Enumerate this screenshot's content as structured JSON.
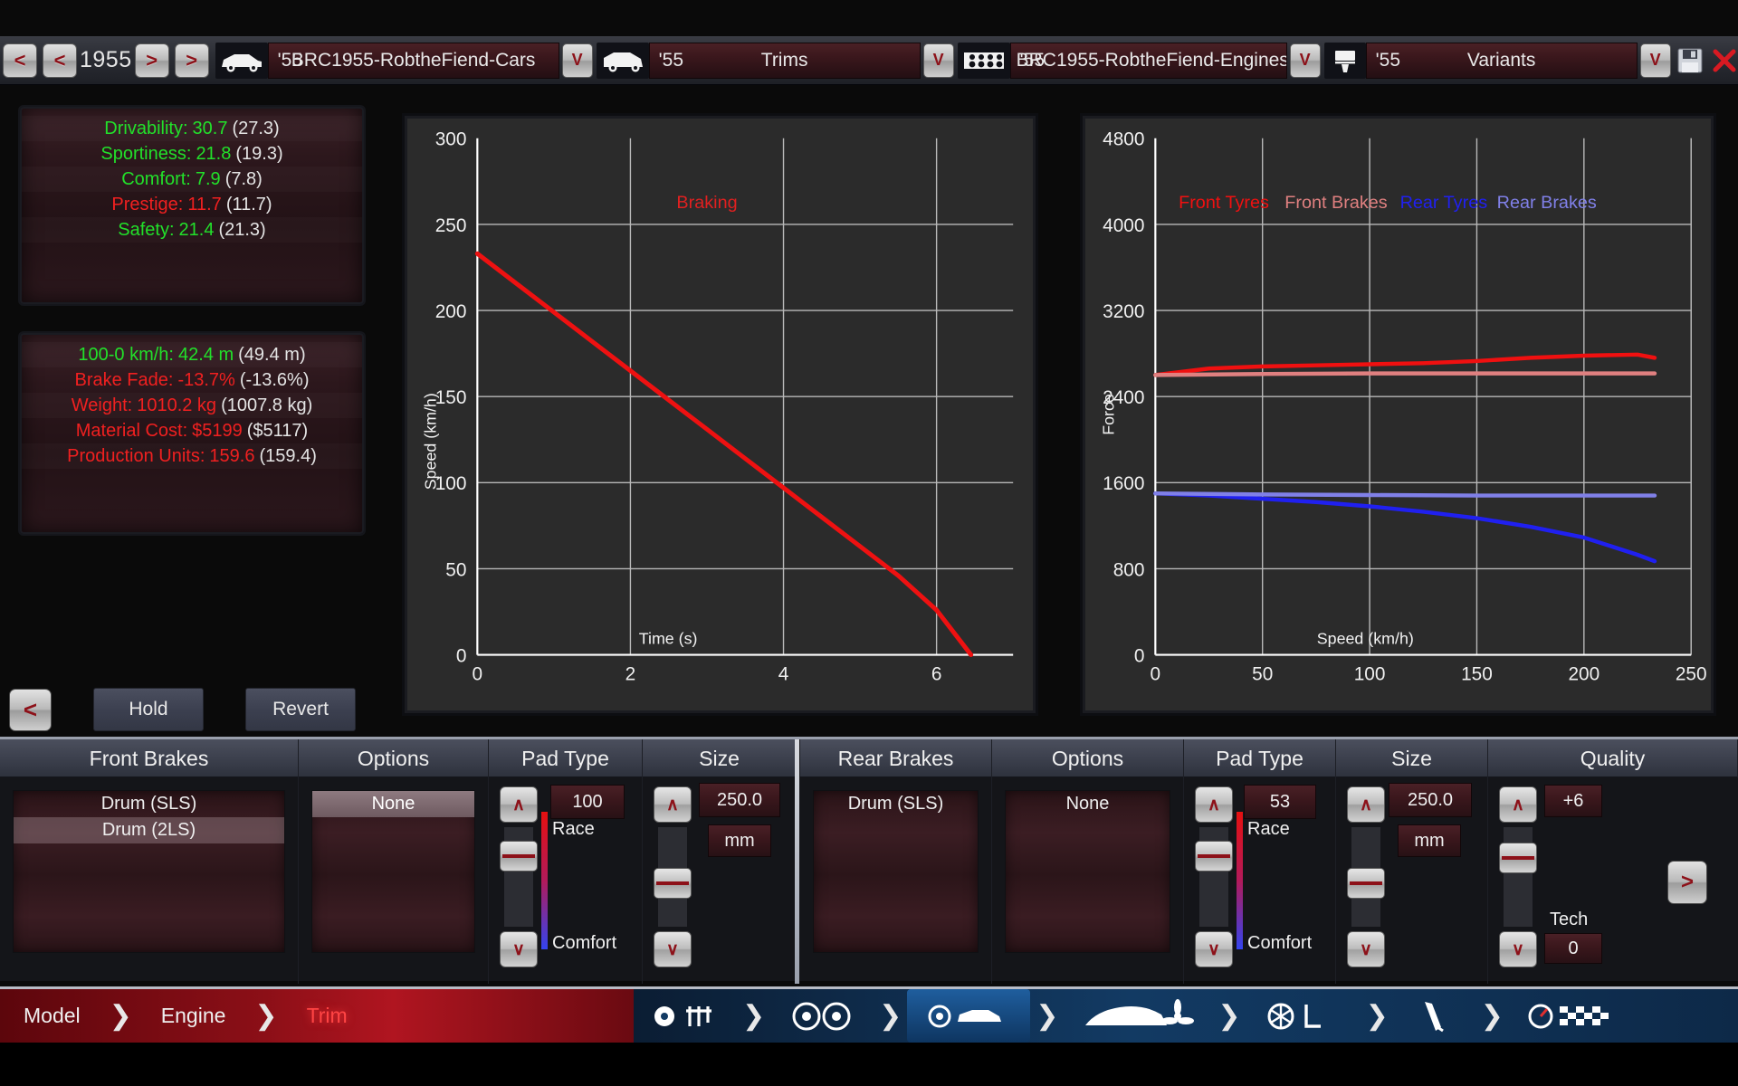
{
  "topbar": {
    "prev_fast_label": "<",
    "prev_label": "<",
    "year": "1955",
    "next_label": ">",
    "next_fast_label": ">",
    "car_icon": "car-icon",
    "car_prefix": "'55",
    "car_value": "BRC1955-RobtheFiend-Cars",
    "car_caret": "V",
    "trim_icon": "van-icon",
    "trim_prefix": "'55",
    "trim_value": "Trims",
    "trim_caret": "V",
    "engine_icon": "engine-icon",
    "engine_prefix": "'55",
    "engine_value": "BRC1955-RobtheFiend-Engines",
    "engine_caret": "V",
    "variant_icon": "piston-icon",
    "variant_prefix": "'55",
    "variant_value": "Variants",
    "variant_caret": "V",
    "save_icon": "save-disk-icon",
    "close_icon": "close-x-icon"
  },
  "stats_top": [
    {
      "key": "Drivability:",
      "value": "30.7",
      "prev": "(27.3)",
      "color": "g"
    },
    {
      "key": "Sportiness:",
      "value": "21.8",
      "prev": "(19.3)",
      "color": "g"
    },
    {
      "key": "Comfort:",
      "value": "7.9",
      "prev": "(7.8)",
      "color": "g"
    },
    {
      "key": "Prestige:",
      "value": "11.7",
      "prev": "(11.7)",
      "color": "r"
    },
    {
      "key": "Safety:",
      "value": "21.4",
      "prev": "(21.3)",
      "color": "g"
    }
  ],
  "stats_bottom": [
    {
      "key": "100-0 km/h:",
      "value": "42.4 m",
      "prev": "(49.4 m)",
      "color": "g"
    },
    {
      "key": "Brake Fade:",
      "value": "-13.7%",
      "prev": "(-13.6%)",
      "color": "r"
    },
    {
      "key": "Weight:",
      "value": "1010.2 kg",
      "prev": "(1007.8 kg)",
      "color": "r"
    },
    {
      "key": "Material Cost:",
      "value": "$5199",
      "prev": "($5117)",
      "color": "r"
    },
    {
      "key": "Production Units:",
      "value": "159.6",
      "prev": "(159.4)",
      "color": "r"
    }
  ],
  "left_controls": {
    "back_arrow": "<",
    "hold_label": "Hold",
    "revert_label": "Revert"
  },
  "chart_data": [
    {
      "id": "braking",
      "type": "line",
      "title": "Braking",
      "title_color": "#e02020",
      "xlabel": "Time (s)",
      "ylabel": "Speed (km/h)",
      "xlim": [
        0,
        7
      ],
      "ylim": [
        0,
        300
      ],
      "xticks": [
        0,
        2,
        4,
        6
      ],
      "yticks": [
        0,
        50,
        100,
        150,
        200,
        250,
        300
      ],
      "grid": true,
      "series": [
        {
          "name": "Braking",
          "color": "#ee1111",
          "x": [
            0.0,
            0.5,
            1.0,
            1.5,
            2.0,
            2.5,
            3.0,
            3.5,
            4.0,
            4.5,
            5.0,
            5.5,
            6.0,
            6.45
          ],
          "y": [
            233,
            216,
            199,
            182,
            165,
            148,
            131,
            114,
            97,
            80,
            63,
            46,
            26,
            0
          ]
        }
      ]
    },
    {
      "id": "force",
      "type": "line",
      "title": "",
      "xlabel": "Speed (km/h)",
      "ylabel": "Force",
      "xlim": [
        0,
        250
      ],
      "ylim": [
        0,
        4800
      ],
      "xticks": [
        0,
        50,
        100,
        150,
        200,
        250
      ],
      "yticks": [
        0,
        800,
        1600,
        2400,
        3200,
        4000,
        4800
      ],
      "grid": true,
      "legend": [
        {
          "label": "Front Tyres",
          "color": "#f01010"
        },
        {
          "label": "Front Brakes",
          "color": "#e08080"
        },
        {
          "label": "Rear Tyres",
          "color": "#2020f0"
        },
        {
          "label": "Rear Brakes",
          "color": "#8080e8"
        }
      ],
      "series": [
        {
          "name": "Front Tyres",
          "color": "#f01010",
          "x": [
            0,
            25,
            50,
            75,
            100,
            125,
            150,
            175,
            200,
            225,
            233
          ],
          "y": [
            2600,
            2660,
            2680,
            2690,
            2700,
            2710,
            2730,
            2760,
            2780,
            2790,
            2760
          ]
        },
        {
          "name": "Front Brakes",
          "color": "#e08080",
          "x": [
            0,
            50,
            100,
            150,
            200,
            233
          ],
          "y": [
            2600,
            2610,
            2615,
            2615,
            2615,
            2615
          ]
        },
        {
          "name": "Rear Tyres",
          "color": "#2020f0",
          "x": [
            0,
            25,
            50,
            75,
            100,
            125,
            150,
            175,
            200,
            225,
            233
          ],
          "y": [
            1500,
            1480,
            1450,
            1420,
            1380,
            1330,
            1270,
            1190,
            1090,
            930,
            870
          ]
        },
        {
          "name": "Rear Brakes",
          "color": "#8080e8",
          "x": [
            0,
            50,
            100,
            150,
            200,
            233
          ],
          "y": [
            1500,
            1490,
            1485,
            1480,
            1480,
            1480
          ]
        }
      ]
    }
  ],
  "front": {
    "col_brakes": "Front Brakes",
    "col_options": "Options",
    "col_padtype": "Pad Type",
    "col_size": "Size",
    "brakes_items": [
      "Drum (SLS)",
      "Drum (2LS)"
    ],
    "brakes_selected_index": 1,
    "options_items": [
      "None"
    ],
    "options_selected_index": 0,
    "pad_value": "100",
    "pad_top_label": "Race",
    "pad_bottom_label": "Comfort",
    "size_value": "250.0",
    "size_unit": "mm",
    "spin_up": "∧",
    "spin_down": "∨"
  },
  "rear": {
    "col_brakes": "Rear Brakes",
    "col_options": "Options",
    "col_padtype": "Pad Type",
    "col_size": "Size",
    "col_quality": "Quality",
    "brakes_items": [
      "Drum (SLS)"
    ],
    "brakes_selected_index": -1,
    "options_items": [
      "None"
    ],
    "options_selected_index": -1,
    "pad_value": "53",
    "pad_top_label": "Race",
    "pad_bottom_label": "Comfort",
    "size_value": "250.0",
    "size_unit": "mm",
    "quality_value": "+6",
    "tech_label": "Tech",
    "tech_value": "0",
    "spin_up": "∧",
    "spin_down": "∨",
    "next_arrow": ">"
  },
  "nav": {
    "model": "Model",
    "engine": "Engine",
    "trim": "Trim",
    "chev": "❯",
    "icons": [
      "gear-gearbox-icon",
      "wheels-icon",
      "chassis-brakes-icon",
      "aero-body-fan-icon",
      "suspension-icon",
      "damper-icon",
      "gauge-finish-icon"
    ]
  }
}
